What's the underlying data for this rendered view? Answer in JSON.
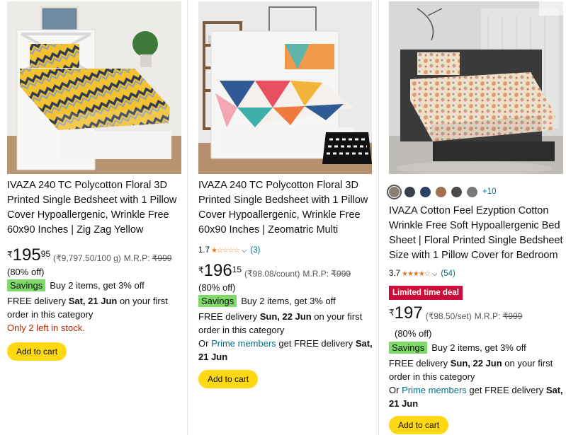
{
  "cards": [
    {
      "title": "IVAZA 240 TC Polycotton Floral 3D Printed Single Bedsheet with 1 Pillow Cover Hypoallergenic, Wrinkle Free 60x90 Inches | Zig Zag Yellow",
      "price_symbol": "₹",
      "price_whole": "195",
      "price_fraction": "95",
      "unit_price": "(₹9,797.50/100 g)",
      "mrp_label": "M.R.P:",
      "mrp_value": "₹999",
      "discount": "(80% off)",
      "savings_badge": "Savings",
      "savings_text": "Buy 2 items, get 3% off",
      "delivery_prefix": "FREE delivery ",
      "delivery_date": "Sat, 21 Jun",
      "delivery_suffix": " on your first order in this category",
      "stock": "Only 2 left in stock.",
      "cart_label": "Add to cart"
    },
    {
      "title": "IVAZA 240 TC Polycotton Floral 3D Printed Single Bedsheet with 1 Pillow Cover Hypoallergenic, Wrinkle Free 60x90 Inches | Zeomatric Multi",
      "rating": "1.7",
      "stars": "★☆☆☆☆",
      "rating_count": "(3)",
      "price_symbol": "₹",
      "price_whole": "196",
      "price_fraction": "15",
      "unit_price": "(₹98.08/count)",
      "mrp_label": "M.R.P:",
      "mrp_value": "₹999",
      "discount": "(80% off)",
      "savings_badge": "Savings",
      "savings_text": "Buy 2 items, get 3% off",
      "delivery_prefix": "FREE delivery ",
      "delivery_date": "Sun, 22 Jun",
      "delivery_suffix": " on your first order in this category",
      "prime_prefix": "Or ",
      "prime_link": "Prime members",
      "prime_mid": " get FREE delivery ",
      "prime_date": "Sat, 21 Jun",
      "cart_label": "Add to cart"
    },
    {
      "swatch_colors": [
        "#8a7f72",
        "#3b3f4a",
        "#2f3f66",
        "#a07050",
        "#4a4a4a",
        "#7a7a7a"
      ],
      "more_colors": "+10",
      "title": "IVAZA Cotton Feel Ezyption Cotton Wrinkle Free Soft Hypoallergenic Bed Sheet | Floral Printed Single Bedsheet Size with 1 Pillow Cover for Bedroom",
      "rating": "3.7",
      "stars": "★★★★☆",
      "rating_count": "(54)",
      "deal_badge": "Limited time deal",
      "price_symbol": "₹",
      "price_whole": "197",
      "unit_price": "(₹98.50/set)",
      "mrp_label": "M.R.P:",
      "mrp_value": "₹999",
      "discount": "(80% off)",
      "savings_badge": "Savings",
      "savings_text": "Buy 2 items, get 3% off",
      "delivery_prefix": "FREE delivery ",
      "delivery_date": "Sun, 22 Jun",
      "delivery_suffix": " on your first order in this category",
      "prime_prefix": "Or ",
      "prime_link": "Prime members",
      "prime_mid": " get FREE delivery ",
      "prime_date": "Sat, 21 Jun",
      "cart_label": "Add to cart"
    }
  ]
}
